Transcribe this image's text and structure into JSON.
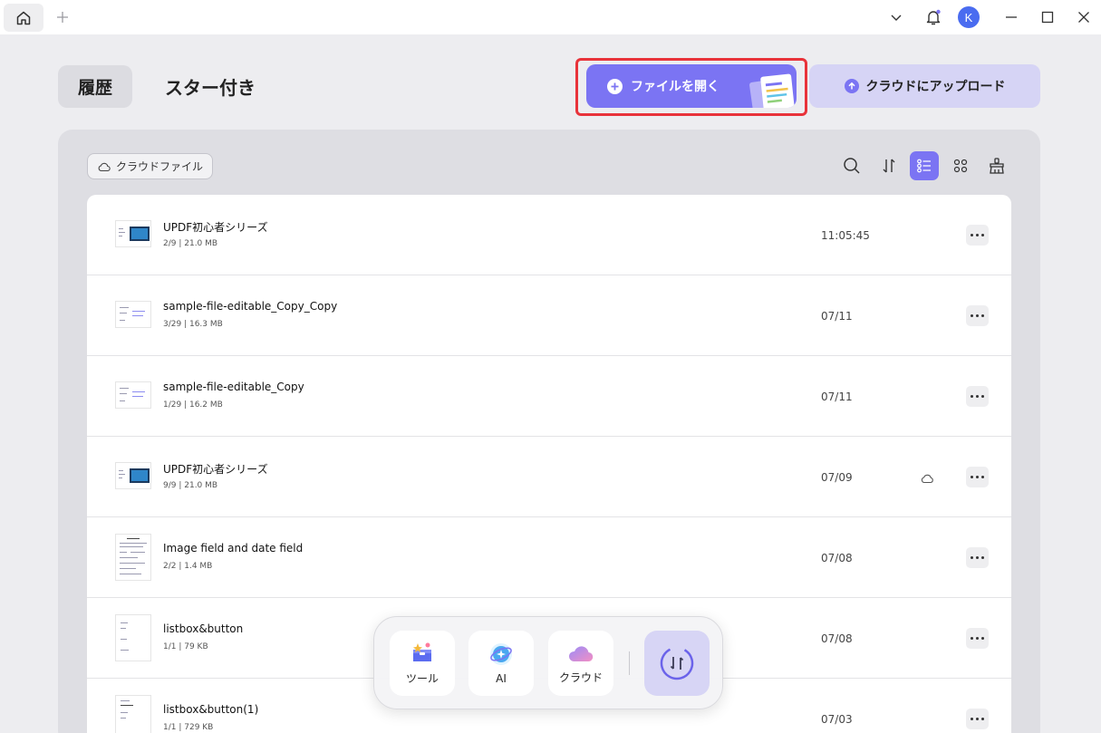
{
  "titlebar": {
    "avatar_letter": "K"
  },
  "header": {
    "tab_history": "履歴",
    "tab_starred": "スター付き",
    "open_file_label": "ファイルを開く",
    "upload_cloud_label": "クラウドにアップロード"
  },
  "toolbar": {
    "cloud_files_label": "クラウドファイル"
  },
  "files": [
    {
      "name": "UPDF初心者シリーズ",
      "meta": "2/9 | 21.0 MB",
      "date": "11:05:45",
      "cloud": false
    },
    {
      "name": "sample-file-editable_Copy_Copy",
      "meta": "3/29 | 16.3 MB",
      "date": "07/11",
      "cloud": false
    },
    {
      "name": "sample-file-editable_Copy",
      "meta": "1/29 | 16.2 MB",
      "date": "07/11",
      "cloud": false
    },
    {
      "name": "UPDF初心者シリーズ",
      "meta": "9/9 | 21.0 MB",
      "date": "07/09",
      "cloud": true
    },
    {
      "name": "Image field and date field",
      "meta": "2/2 | 1.4 MB",
      "date": "07/08",
      "cloud": false
    },
    {
      "name": "listbox&button",
      "meta": "1/1 | 79 KB",
      "date": "07/08",
      "cloud": false
    },
    {
      "name": "listbox&button(1)",
      "meta": "1/1 | 729 KB",
      "date": "07/03",
      "cloud": false
    }
  ],
  "dock": {
    "tools_label": "ツール",
    "ai_label": "AI",
    "cloud_label": "クラウド"
  },
  "colors": {
    "accent": "#7b74f3",
    "highlight": "#e8333a",
    "avatar": "#4a6cf0"
  }
}
